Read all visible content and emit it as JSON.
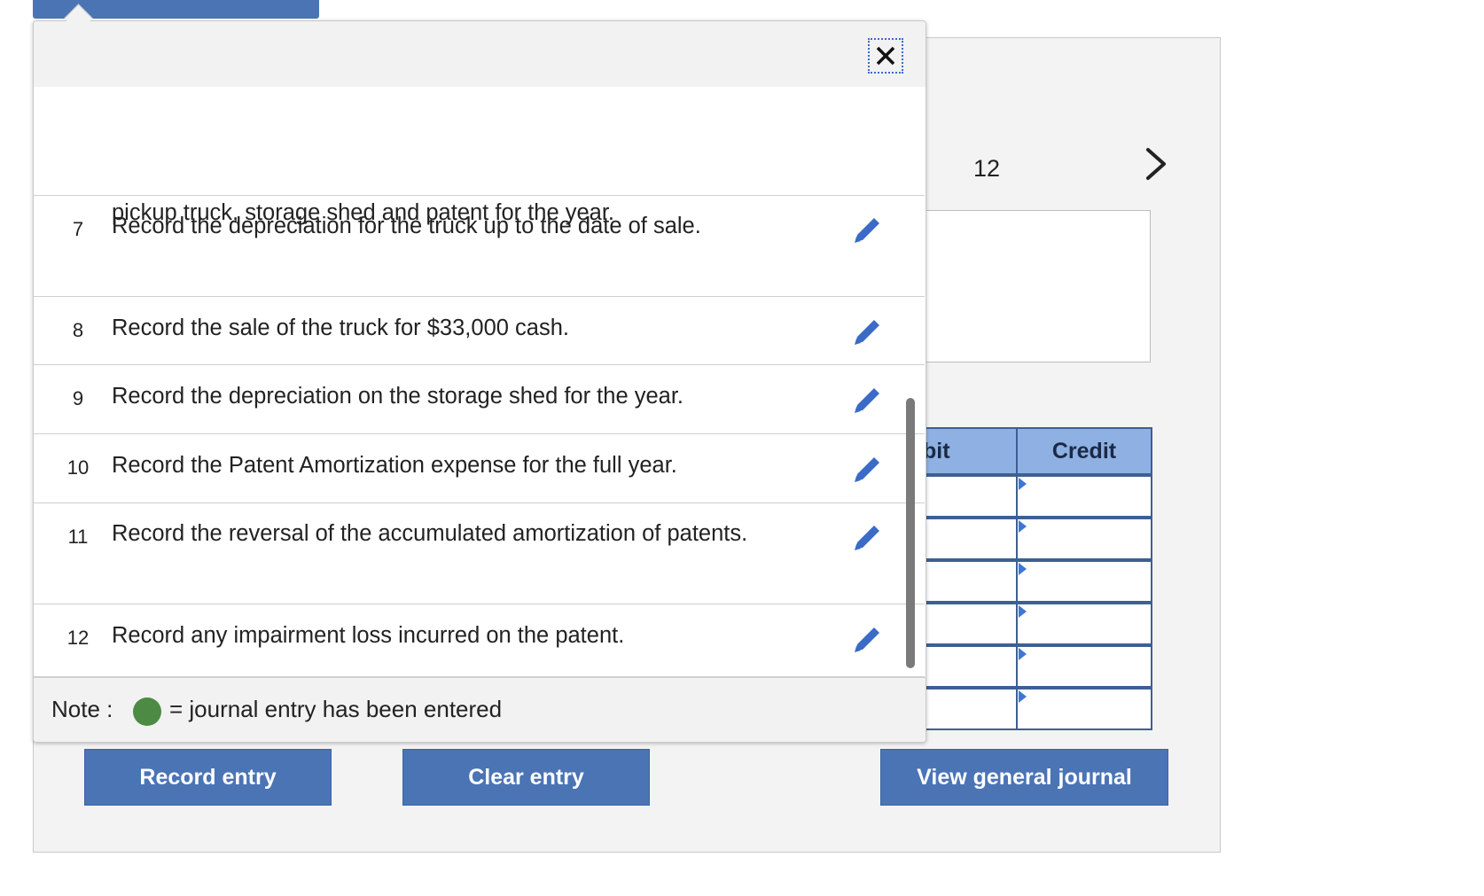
{
  "background_panel": {
    "entry_number": "12",
    "next_icon": "chevron-right-icon",
    "table": {
      "debit_header_partial": "bit",
      "credit_header": "Credit",
      "row_count": 6
    }
  },
  "buttons": {
    "record_entry": "Record entry",
    "clear_entry": "Clear entry",
    "view_general_journal": "View general journal"
  },
  "popup": {
    "close_icon": "close-icon",
    "rows": [
      {
        "number": "",
        "text": "pickup truck, storage shed and patent for the year.",
        "has_edit": false
      },
      {
        "number": "7",
        "text": "Record the depreciation for the truck up to the date of sale.",
        "has_edit": true
      },
      {
        "number": "8",
        "text": "Record the sale of the truck for $33,000 cash.",
        "has_edit": true
      },
      {
        "number": "9",
        "text": "Record the depreciation on the storage shed for the year.",
        "has_edit": true
      },
      {
        "number": "10",
        "text": "Record the Patent Amortization expense for the full year.",
        "has_edit": true
      },
      {
        "number": "11",
        "text": "Record the reversal of the accumulated amortization of patents.",
        "has_edit": true
      },
      {
        "number": "12",
        "text": "Record any impairment loss incurred on the patent.",
        "has_edit": true
      }
    ],
    "note": {
      "label": "Note :",
      "text": "= journal entry has been entered",
      "dot_color": "#4d8a44"
    }
  },
  "colors": {
    "accent": "#4b74b5",
    "table_header": "#8eb0e3",
    "pencil": "#3b6bc7"
  }
}
